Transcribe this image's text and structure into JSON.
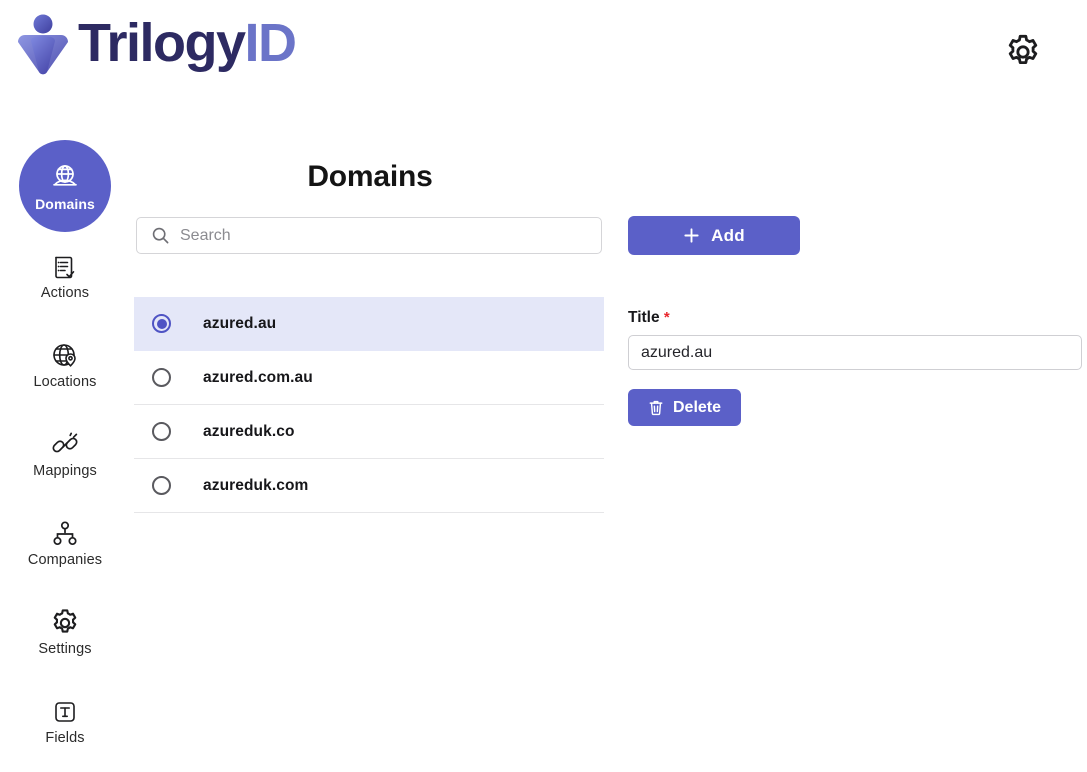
{
  "header": {
    "brand_primary": "Trilogy",
    "brand_secondary": "ID",
    "settings_icon": "gear-icon",
    "brand_primary_color": "#2d2a62",
    "brand_secondary_color": "#6b74c8"
  },
  "theme": {
    "accent": "#5b60c8",
    "accent_dark": "#4f54c4",
    "selected_row_bg": "#e4e7f8",
    "required_star": "#e8272c"
  },
  "sidebar": {
    "items": [
      {
        "label": "Domains",
        "icon": "globe-stand-icon",
        "active": true
      },
      {
        "label": "Actions",
        "icon": "clipboard-check-icon",
        "active": false
      },
      {
        "label": "Locations",
        "icon": "globe-pin-icon",
        "active": false
      },
      {
        "label": "Mappings",
        "icon": "connector-plug-icon",
        "active": false
      },
      {
        "label": "Companies",
        "icon": "org-chart-icon",
        "active": false
      },
      {
        "label": "Settings",
        "icon": "gear-icon",
        "active": false
      },
      {
        "label": "Fields",
        "icon": "text-box-icon",
        "active": false
      }
    ]
  },
  "main": {
    "title": "Domains",
    "search": {
      "value": "",
      "placeholder": "Search",
      "icon": "search-icon"
    },
    "add_button": {
      "label": "Add",
      "icon": "plus-icon"
    },
    "list": {
      "selected_index": 0,
      "rows": [
        {
          "name": "azured.au"
        },
        {
          "name": "azured.com.au"
        },
        {
          "name": "azureduk.co"
        },
        {
          "name": "azureduk.com"
        }
      ]
    }
  },
  "detail": {
    "title_label": "Title",
    "title_required_marker": "*",
    "title_value": "azured.au",
    "delete_button": {
      "label": "Delete",
      "icon": "trash-icon"
    }
  }
}
